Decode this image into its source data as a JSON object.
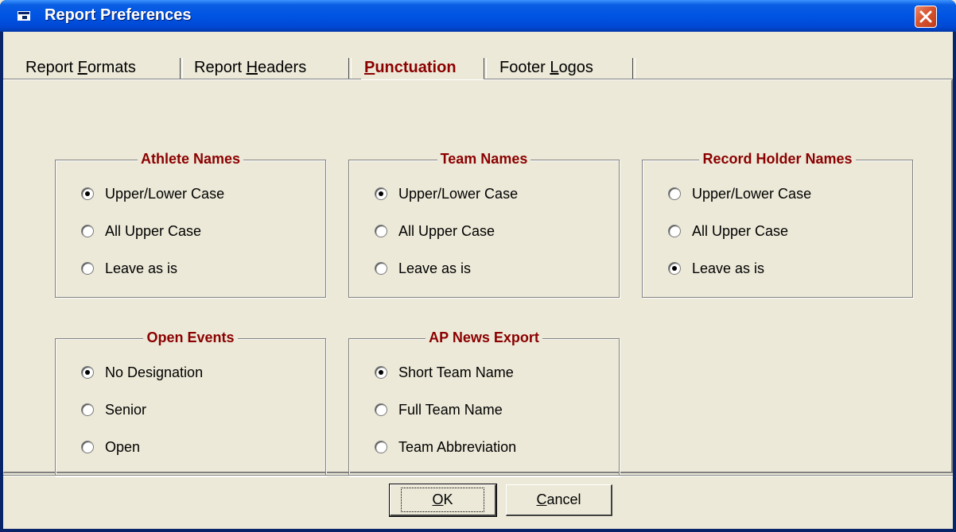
{
  "window": {
    "title": "Report Preferences"
  },
  "tabs": [
    {
      "label_pre": "Report ",
      "label_u": "F",
      "label_post": "ormats",
      "active": false
    },
    {
      "label_pre": "Report ",
      "label_u": "H",
      "label_post": "eaders",
      "active": false
    },
    {
      "label_pre": "",
      "label_u": "P",
      "label_post": "unctuation",
      "active": true
    },
    {
      "label_pre": "Footer ",
      "label_u": "L",
      "label_post": "ogos",
      "active": false
    }
  ],
  "groups": {
    "athlete_names": {
      "title": "Athlete Names",
      "options": [
        "Upper/Lower Case",
        "All Upper Case",
        "Leave as is"
      ],
      "selected": "Upper/Lower Case"
    },
    "team_names": {
      "title": "Team Names",
      "options": [
        "Upper/Lower Case",
        "All Upper Case",
        "Leave as is"
      ],
      "selected": "Upper/Lower Case"
    },
    "record_holder_names": {
      "title": "Record Holder Names",
      "options": [
        "Upper/Lower Case",
        "All Upper Case",
        "Leave as is"
      ],
      "selected": "Leave as is"
    },
    "open_events": {
      "title": "Open Events",
      "options": [
        "No Designation",
        "Senior",
        "Open"
      ],
      "selected": "No Designation"
    },
    "ap_news_export": {
      "title": "AP News Export",
      "options": [
        "Short Team Name",
        "Full Team Name",
        "Team Abbreviation"
      ],
      "selected": "Short Team Name"
    }
  },
  "buttons": {
    "ok_u": "O",
    "ok_post": "K",
    "cancel_u": "C",
    "cancel_post": "ancel"
  },
  "colors": {
    "title_bar": "#0054e3",
    "group_title": "#8b0000",
    "face": "#ece9d8"
  }
}
